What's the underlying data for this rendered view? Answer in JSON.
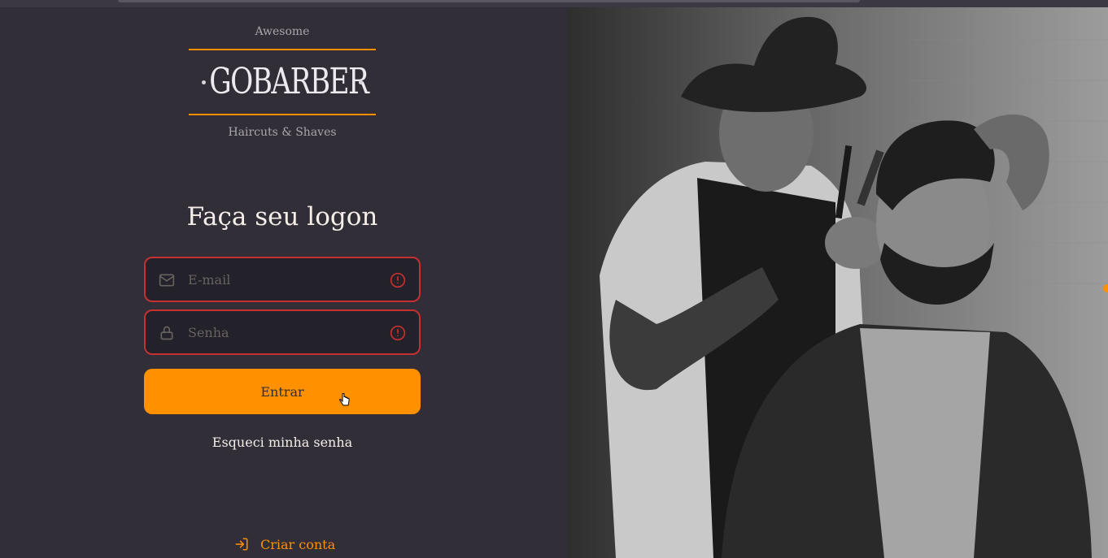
{
  "logo": {
    "tagline_top": "Awesome",
    "name": "GOBARBER",
    "tagline_bottom": "Haircuts & Shaves"
  },
  "form": {
    "title": "Faça seu logon",
    "email": {
      "placeholder": "E-mail",
      "value": "",
      "icon": "mail-icon",
      "error_icon": "alert-circle-icon"
    },
    "password": {
      "placeholder": "Senha",
      "value": "",
      "icon": "lock-icon",
      "error_icon": "alert-circle-icon"
    },
    "submit_label": "Entrar",
    "forgot_label": "Esqueci minha senha"
  },
  "footer": {
    "create_account_label": "Criar conta",
    "create_account_icon": "log-in-icon"
  },
  "colors": {
    "background": "#312e38",
    "accent": "#ff9000",
    "input_background": "#232129",
    "error": "#c53030",
    "text": "#f4ede8",
    "placeholder": "#666360"
  }
}
